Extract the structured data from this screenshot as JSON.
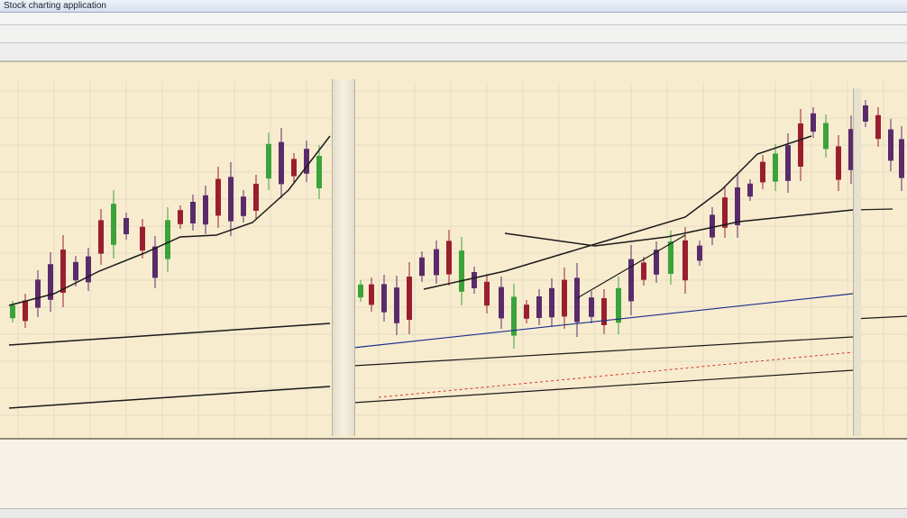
{
  "window": {
    "title": "Stock charting application"
  },
  "menu": [],
  "toolbar": {
    "buttons": [],
    "highlight": ""
  },
  "tabs": [],
  "chart_panel": {
    "title": "",
    "subtitle": "",
    "right_tabs": [],
    "logo": ""
  },
  "colors": {
    "background": "#f8eccf",
    "grid": "#e4dbc4",
    "bull": "#3aa33a",
    "bear": "#9a1f2e",
    "neutral": "#5a2b6b",
    "trend_dark": "#1a1a1a",
    "trend_blue": "#1c2e8c",
    "trend_red": "#d23a2a"
  },
  "table": {
    "headers": [],
    "rows": []
  },
  "status": ""
}
